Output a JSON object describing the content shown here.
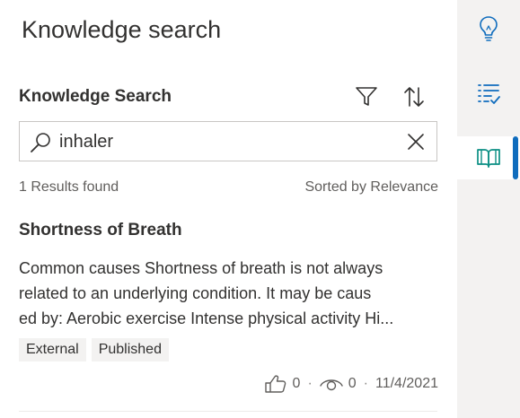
{
  "panel": {
    "title": "Knowledge search"
  },
  "search_section": {
    "title": "Knowledge Search",
    "filter_icon": "filter-icon",
    "sort_icon": "sort-icon",
    "search": {
      "value": "inhaler",
      "icon": "search-icon",
      "clear_icon": "close-icon"
    },
    "results_count": "1 Results found",
    "sorted_by": "Sorted by Relevance"
  },
  "results": [
    {
      "title": "Shortness of Breath",
      "body_lines": [
        "Common causes Shortness of breath is not always",
        "related to an underlying condition. It may be caus",
        "ed by: Aerobic exercise Intense physical activity Hi..."
      ],
      "tags": [
        "External",
        "Published"
      ],
      "likes": "0",
      "views": "0",
      "date": "11/4/2021"
    }
  ],
  "rail": {
    "items": [
      {
        "icon": "lightbulb-icon",
        "active": false
      },
      {
        "icon": "checklist-icon",
        "active": false
      },
      {
        "icon": "book-icon",
        "active": true
      }
    ],
    "accent_color": "#0f6cbd",
    "book_icon_color": "#0b8f84"
  },
  "meta_separator": "·"
}
